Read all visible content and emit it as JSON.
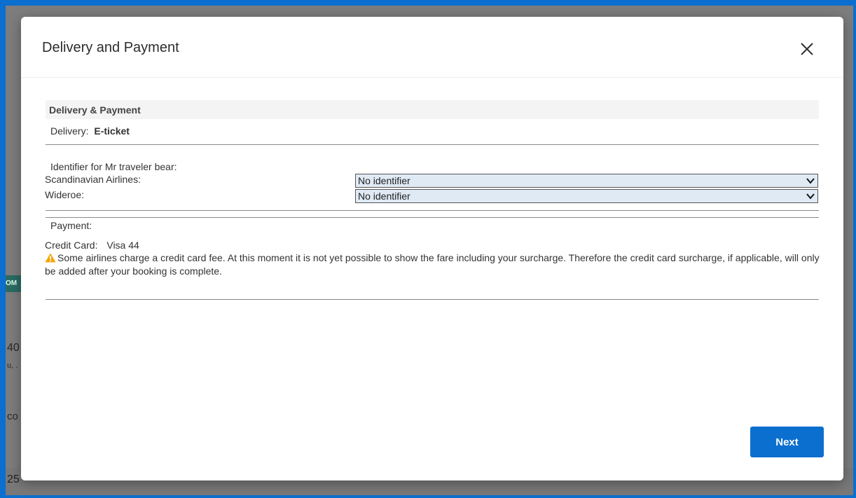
{
  "modal": {
    "title": "Delivery and Payment",
    "section_title": "Delivery & Payment",
    "delivery_label": "Delivery:",
    "delivery_value": "E-ticket",
    "identifier_title": "Identifier for Mr traveler bear:",
    "identifiers": [
      {
        "airline": "Scandinavian Airlines:",
        "selected": "No identifier"
      },
      {
        "airline": "Wideroe:",
        "selected": "No identifier"
      }
    ],
    "payment_label": "Payment:",
    "credit_card_label": "Credit Card:",
    "credit_card_value": "Visa 44",
    "warning_text": "Some airlines charge a credit card fee. At this moment it is not yet possible to show the fare including your surcharge. Therefore the credit card surcharge, if applicable, will only be added after your booking is complete.",
    "next_label": "Next"
  },
  "background": {
    "chip_text": "OM",
    "fragment_1": "40",
    "fragment_2": "u, .",
    "fragment_3": "co",
    "bottom_row": [
      "25",
      "",
      "",
      ""
    ]
  },
  "colors": {
    "accent": "#0b6fcf",
    "select_bg": "#dfeaf5",
    "warning_icon": "#f5a300"
  }
}
